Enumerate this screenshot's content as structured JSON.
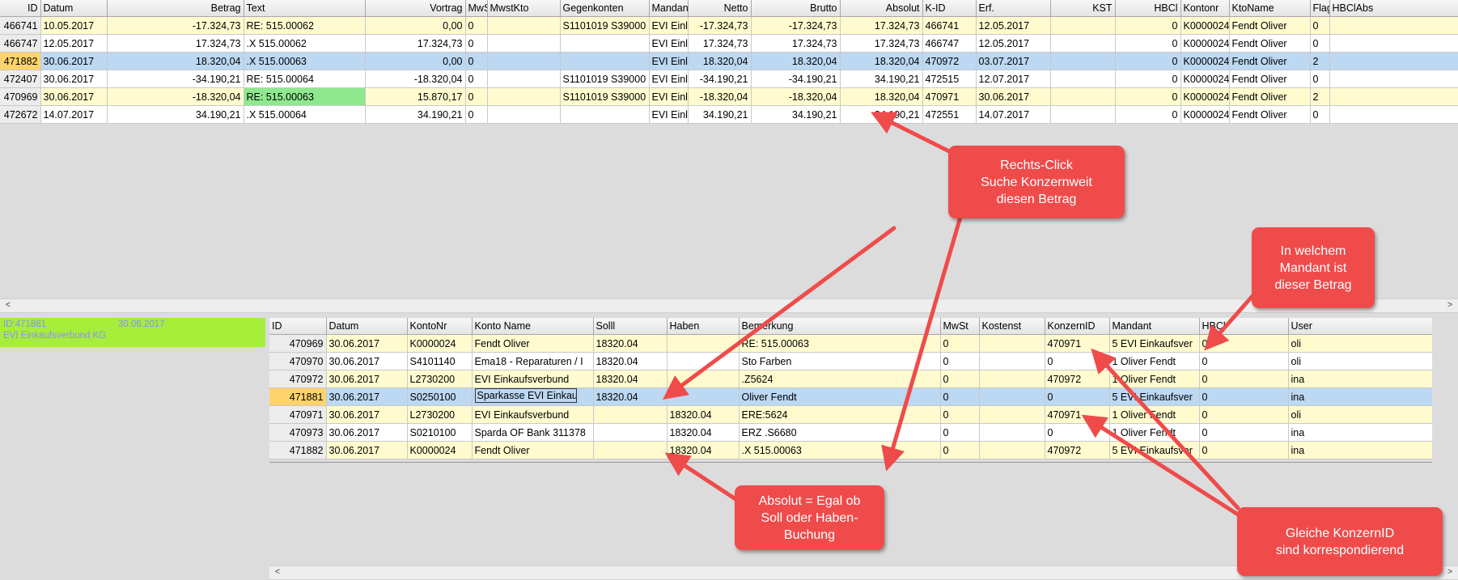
{
  "top_grid": {
    "columns": [
      "ID",
      "Datum",
      "Betrag",
      "Text",
      "Vortrag",
      "MwS",
      "MwstKto",
      "Gegenkonten",
      "Mandan",
      "Netto",
      "Brutto",
      "Absolut",
      "K-ID",
      "Erf.",
      "KST",
      "HBCl",
      "Kontonr",
      "KtoName",
      "Flag",
      "HBClAbs"
    ],
    "rows": [
      {
        "style": "y",
        "cells": [
          "466741",
          "10.05.2017",
          "-17.324,73",
          "RE: 515.00062",
          "0,00",
          "0",
          "",
          "S1101019 S39000",
          "EVI Einl",
          "-17.324,73",
          "-17.324,73",
          "17.324,73",
          "466741",
          "12.05.2017",
          "",
          "0",
          "K0000024",
          "Fendt Oliver",
          "0",
          ""
        ]
      },
      {
        "style": "w",
        "cells": [
          "466747",
          "12.05.2017",
          "17.324,73",
          ".X 515.00062",
          "17.324,73",
          "0",
          "",
          "",
          "EVI Einl",
          "17.324,73",
          "17.324,73",
          "17.324,73",
          "466747",
          "12.05.2017",
          "",
          "0",
          "K0000024",
          "Fendt Oliver",
          "0",
          ""
        ]
      },
      {
        "style": "sel",
        "cells": [
          "471882",
          "30.06.2017",
          "18.320,04",
          ".X 515.00063",
          "0,00",
          "0",
          "",
          "",
          "EVI Einl",
          "18.320,04",
          "18.320,04",
          "18.320,04",
          "470972",
          "03.07.2017",
          "",
          "0",
          "K0000024",
          "Fendt Oliver",
          "2",
          ""
        ]
      },
      {
        "style": "w",
        "cells": [
          "472407",
          "30.06.2017",
          "-34.190,21",
          "RE: 515.00064",
          "-18.320,04",
          "0",
          "",
          "S1101019 S39000",
          "EVI Einl",
          "-34.190,21",
          "-34.190,21",
          "34.190,21",
          "472515",
          "12.07.2017",
          "",
          "0",
          "K0000024",
          "Fendt Oliver",
          "0",
          ""
        ]
      },
      {
        "style": "y",
        "cells": [
          "470969",
          "30.06.2017",
          "-18.320,04",
          "RE: 515.00063",
          "15.870,17",
          "0",
          "",
          "S1101019 S39000",
          "EVI Einl",
          "-18.320,04",
          "-18.320,04",
          "18.320,04",
          "470971",
          "30.06.2017",
          "",
          "0",
          "K0000024",
          "Fendt Oliver",
          "2",
          ""
        ]
      },
      {
        "style": "w",
        "cells": [
          "472672",
          "14.07.2017",
          "34.190,21",
          ".X 515.00064",
          "34.190,21",
          "0",
          "",
          "",
          "EVI Einl",
          "34.190,21",
          "34.190,21",
          "34.190,21",
          "472551",
          "14.07.2017",
          "",
          "0",
          "K0000024",
          "Fendt Oliver",
          "0",
          ""
        ]
      }
    ]
  },
  "info_panel": {
    "id": "ID:471881",
    "date": "30.06.2017",
    "name": "EVI Einkaufsverbund KG"
  },
  "bottom_grid": {
    "columns": [
      "ID",
      "Datum",
      "KontoNr",
      "Konto Name",
      "Solll",
      "Haben",
      "Bemerkung",
      "MwSt",
      "Kostenst",
      "KonzernID",
      "Mandant",
      "HBCl",
      "User"
    ],
    "rows": [
      {
        "style": "y",
        "cells": [
          "470969",
          "30.06.2017",
          "K0000024",
          "Fendt Oliver",
          "18320.04",
          "",
          "RE: 515.00063",
          "0",
          "",
          "470971",
          "5 EVI Einkaufsver",
          "0",
          "oli"
        ]
      },
      {
        "style": "w",
        "cells": [
          "470970",
          "30.06.2017",
          "S4101140",
          "Ema18  - Reparaturen / I",
          "18320.04",
          "",
          "Sto Farben",
          "0",
          "",
          "0",
          "1 Oliver Fendt",
          "0",
          "oli"
        ]
      },
      {
        "style": "y",
        "cells": [
          "470972",
          "30.06.2017",
          "L2730200",
          "EVI Einkaufsverbund",
          "18320.04",
          "",
          ".Z5624",
          "0",
          "",
          "470972",
          "1 Oliver Fendt",
          "0",
          "ina"
        ]
      },
      {
        "style": "sel",
        "cells": [
          "471881",
          "30.06.2017",
          "S0250100",
          "Sparkasse EVI Einkaufs",
          "18320.04",
          "",
          "Oliver Fendt",
          "0",
          "",
          "0",
          "5 EVI Einkaufsver",
          "0",
          "ina"
        ]
      },
      {
        "style": "y",
        "cells": [
          "470971",
          "30.06.2017",
          "L2730200",
          "EVI Einkaufsverbund",
          "",
          "18320.04",
          "ERE:5624",
          "0",
          "",
          "470971",
          "1 Oliver Fendt",
          "0",
          "oli"
        ]
      },
      {
        "style": "w",
        "cells": [
          "470973",
          "30.06.2017",
          "S0210100",
          "Sparda OF Bank 311378",
          "",
          "18320.04",
          "ERZ .S6680",
          "0",
          "",
          "0",
          "1 Oliver Fendt",
          "0",
          "ina"
        ]
      },
      {
        "style": "y",
        "cells": [
          "471882",
          "30.06.2017",
          "K0000024",
          "Fendt Oliver",
          "",
          "18320.04",
          ".X 515.00063",
          "0",
          "",
          "470972",
          "5 EVI Einkaufsver",
          "0",
          "ina"
        ]
      }
    ]
  },
  "callouts": {
    "rechtsclick": [
      "Rechts-Click",
      "Suche Konzernweit",
      "diesen Betrag"
    ],
    "mandant": [
      "In welchem",
      "Mandant ist",
      "dieser Betrag"
    ],
    "absolut": [
      "Absolut = Egal ob",
      "Soll oder Haben-",
      "Buchung"
    ],
    "konzernid": [
      "Gleiche KonzernID",
      "sind korrespondierend"
    ]
  },
  "colors": {
    "callout": "#ef4b4b",
    "row_yellow": "#fffbcf",
    "row_selected": "#bcd8f3",
    "info_panel": "#a6ee3a"
  }
}
